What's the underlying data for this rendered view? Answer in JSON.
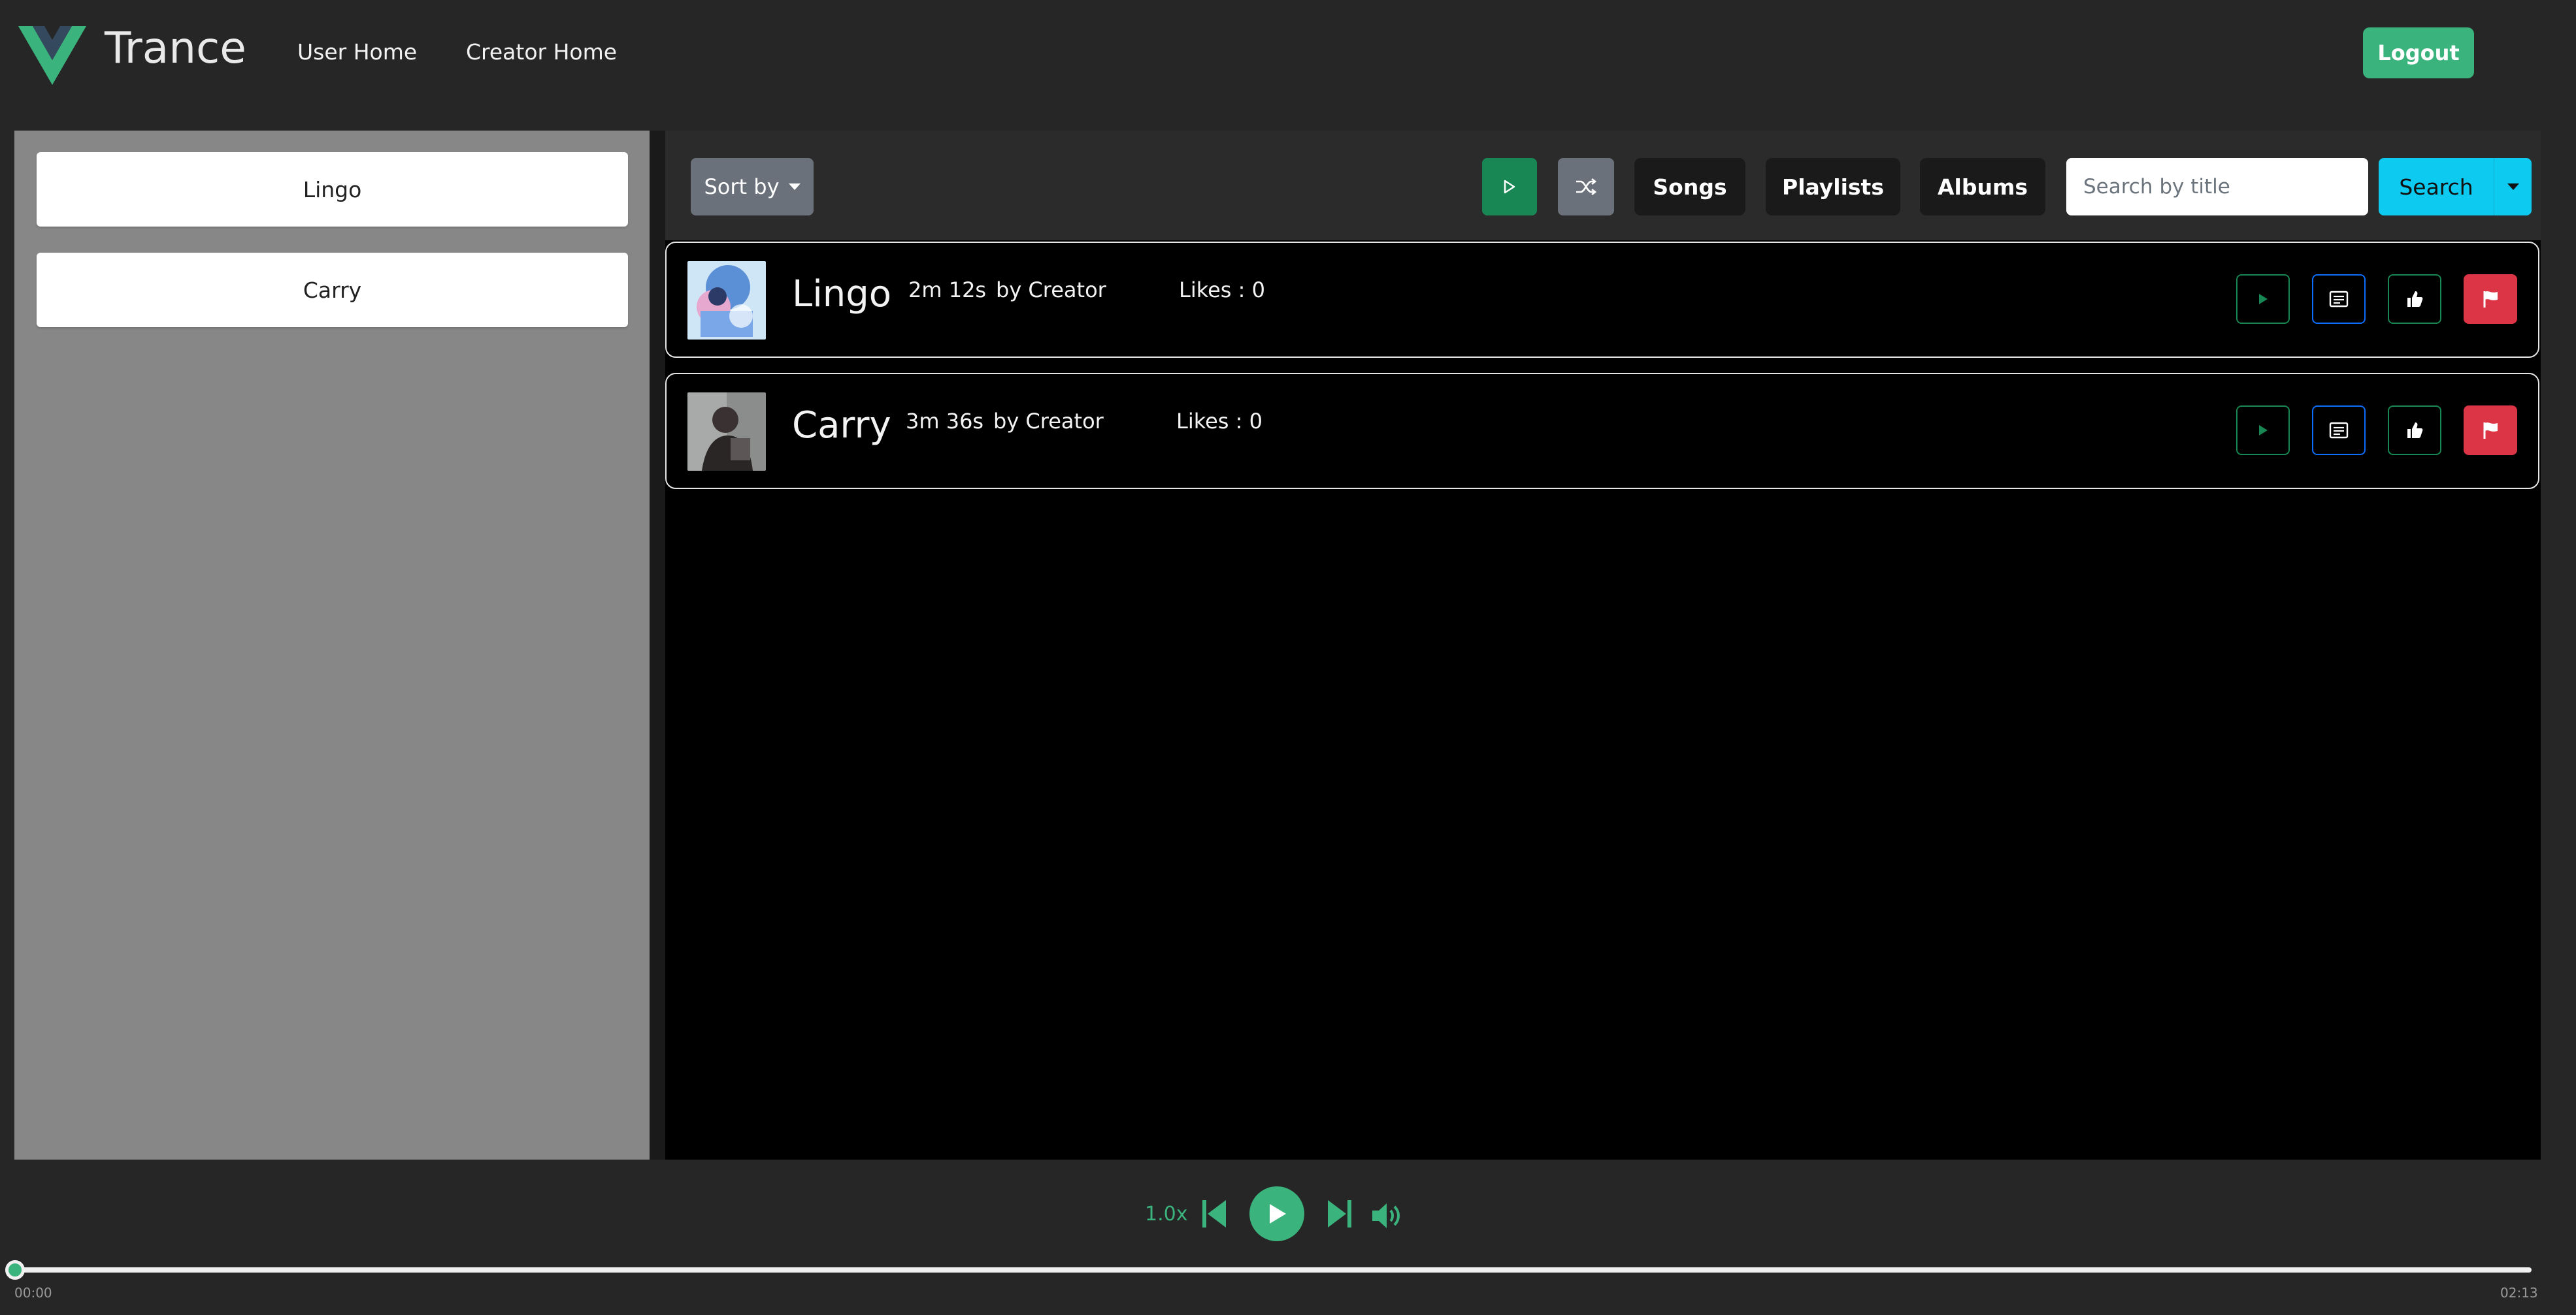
{
  "app": {
    "brand": "Trance",
    "accent_color": "#3bb37d",
    "logo_icon": "vue-logo-icon"
  },
  "nav": {
    "links": [
      {
        "label": "User Home"
      },
      {
        "label": "Creator Home"
      }
    ],
    "logout_label": "Logout"
  },
  "sidebar": {
    "items": [
      {
        "label": "Lingo"
      },
      {
        "label": "Carry"
      }
    ]
  },
  "toolbar": {
    "sort_label": "Sort by",
    "play_all_icon": "play-icon",
    "shuffle_icon": "shuffle-icon",
    "filters": [
      {
        "label": "Songs"
      },
      {
        "label": "Playlists"
      },
      {
        "label": "Albums"
      }
    ],
    "search": {
      "placeholder": "Search by title",
      "value": "",
      "button_label": "Search"
    }
  },
  "songs": [
    {
      "title": "Lingo",
      "duration": "2m 12s",
      "artist": "by Creator",
      "likes": "Likes : 0"
    },
    {
      "title": "Carry",
      "duration": "3m 36s",
      "artist": "by Creator",
      "likes": "Likes : 0"
    }
  ],
  "row_actions": {
    "play_icon": "play-icon",
    "lyrics_icon": "lyrics-icon",
    "like_icon": "thumbs-up-icon",
    "flag_icon": "flag-icon"
  },
  "player": {
    "speed": "1.0x",
    "current_time": "00:00",
    "total_time": "02:13",
    "progress": 0
  }
}
